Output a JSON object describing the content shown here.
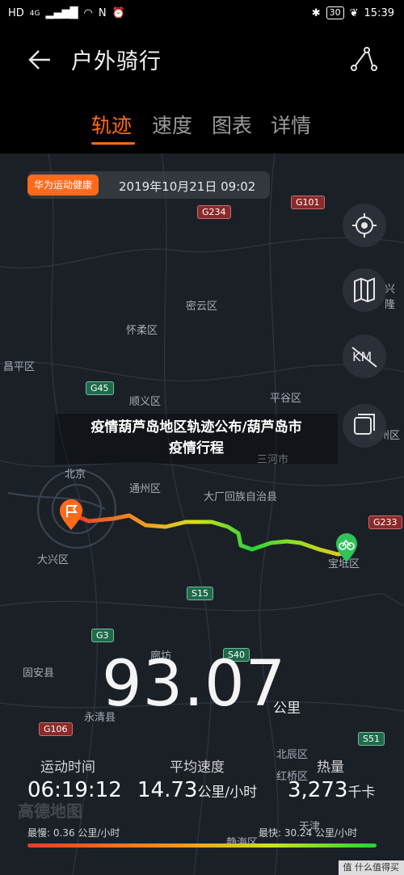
{
  "status_bar": {
    "network": "HD",
    "signal": "4G",
    "battery": "30",
    "time": "15:39"
  },
  "header": {
    "title": "户外骑行"
  },
  "tabs": [
    {
      "label": "轨迹",
      "active": true
    },
    {
      "label": "速度",
      "active": false
    },
    {
      "label": "图表",
      "active": false
    },
    {
      "label": "详情",
      "active": false
    }
  ],
  "map": {
    "source_badge": "华为运动健康",
    "datetime": "2019年10月21日 09:02",
    "labels": [
      "密云区",
      "怀柔区",
      "昌平区",
      "顺义区",
      "平谷区",
      "三河市",
      "北京",
      "通州区",
      "大厂回族自治县",
      "大兴区",
      "廊坊",
      "固安县",
      "永清县",
      "北辰区",
      "宝坻区",
      "兴隆",
      "蓟州区",
      "红桥区",
      "天津",
      "静海区"
    ],
    "roads": {
      "g234": "G234",
      "g101": "G101",
      "g45": "G45",
      "g233": "G233",
      "s15": "S15",
      "g3": "G3",
      "s40": "S40",
      "g106": "G106",
      "s51": "S51"
    },
    "controls": [
      "locate-icon",
      "map-layer-icon",
      "km-marker-icon",
      "expand-icon"
    ],
    "overlay_title_line1": "疫情葫芦岛地区轨迹公布/葫芦岛市",
    "overlay_title_line2": "疫情行程",
    "watermark": "高德地图"
  },
  "summary": {
    "distance": "93.07",
    "distance_unit": "公里",
    "duration_label": "运动时间",
    "duration": "06:19:12",
    "avg_speed_label": "平均速度",
    "avg_speed": "14.73",
    "avg_speed_unit": "公里/小时",
    "heat_label": "热量",
    "calories": "3,273",
    "calories_unit": "千卡",
    "slowest": "最慢:  0.36 公里/小时",
    "fastest": "最快:  30.24 公里/小时"
  },
  "corner_watermark": "值 什么值得买",
  "colors": {
    "accent": "#ff6a1a",
    "slow": "#e83a2a",
    "fast": "#26d13a"
  }
}
